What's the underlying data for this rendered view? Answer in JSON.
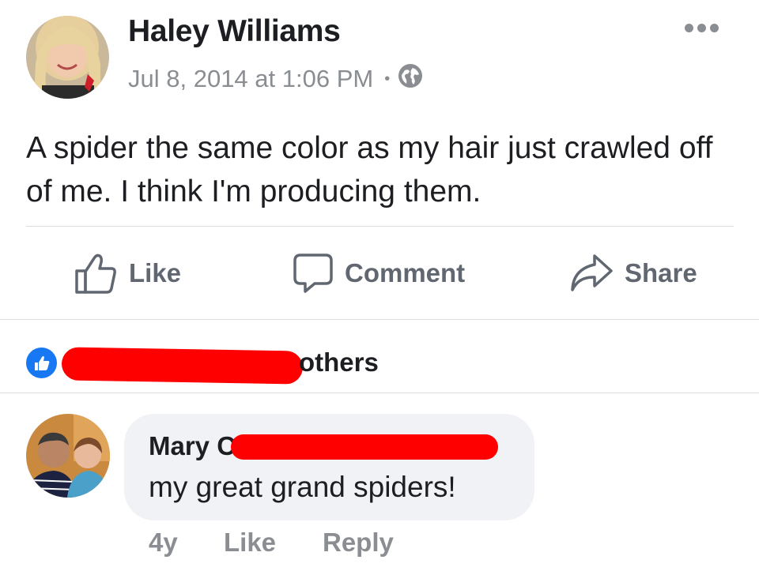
{
  "post": {
    "author": "Haley Williams",
    "timestamp": "Jul 8, 2014 at 1:06 PM",
    "separator": "•",
    "privacy_icon": "globe-icon",
    "text": "A spider the same color as my hair just crawled off of me. I think I'm producing them."
  },
  "actions": {
    "like_label": "Like",
    "comment_label": "Comment",
    "share_label": "Share"
  },
  "reactions": {
    "icon": "thumbs-up-icon",
    "summary_suffix": "others"
  },
  "comment": {
    "author_visible": "Mary C",
    "text": "my great grand spiders!",
    "age": "4y",
    "like_label": "Like",
    "reply_label": "Reply"
  },
  "colors": {
    "brand_blue": "#1877f2",
    "secondary_text": "#8a8d91",
    "action_text": "#606770",
    "bubble_bg": "#f0f2f5",
    "redaction": "#ff0000"
  }
}
